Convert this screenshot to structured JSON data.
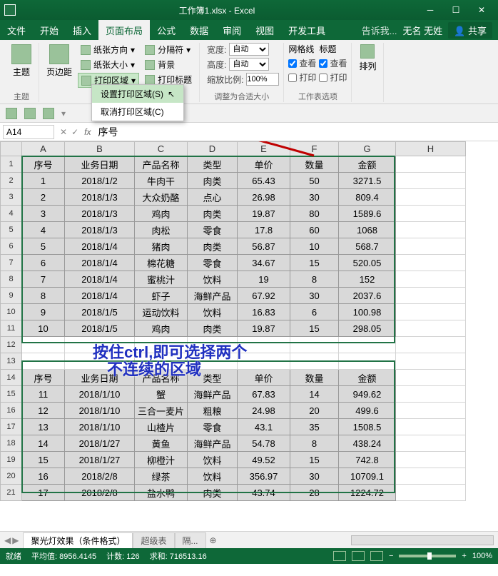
{
  "title": "工作簿1.xlsx - Excel",
  "menu": {
    "file": "文件",
    "home": "开始",
    "insert": "插入",
    "pageLayout": "页面布局",
    "formulas": "公式",
    "data": "数据",
    "review": "审阅",
    "view": "视图",
    "devtools": "开发工具",
    "tell": "告诉我...",
    "user": "无名 无姓",
    "share": "共享"
  },
  "ribbon": {
    "g_themes": {
      "label": "主题",
      "btn": "主题"
    },
    "g_margins": {
      "label": "",
      "btn": "页边距"
    },
    "g_pageSetup": {
      "orientation": "纸张方向",
      "size": "纸张大小",
      "printArea": "打印区域",
      "breaks": "分隔符",
      "background": "背景",
      "printTitles": "打印标题"
    },
    "g_printAreaMenu": {
      "set": "设置打印区域(S)",
      "clear": "取消打印区域(C)"
    },
    "g_scale": {
      "groupLabel": "调整为合适大小",
      "width": "宽度:",
      "widthVal": "自动",
      "height": "高度:",
      "heightVal": "自动",
      "scale": "缩放比例:",
      "scaleVal": "100%"
    },
    "g_gridlines": {
      "gridlines": "网格线",
      "headings": "标题",
      "view": "查看",
      "print": "打印",
      "groupLabel": "工作表选项"
    },
    "g_arrange": {
      "btn": "排列"
    }
  },
  "nameBox": "A14",
  "formula": "序号",
  "columns": [
    "",
    "A",
    "B",
    "C",
    "D",
    "E",
    "F",
    "G",
    "H"
  ],
  "headers": [
    "序号",
    "业务日期",
    "产品名称",
    "类型",
    "单价",
    "数量",
    "金额"
  ],
  "rows1": [
    [
      "1",
      "2018/1/2",
      "牛肉干",
      "肉类",
      "65.43",
      "50",
      "3271.5"
    ],
    [
      "2",
      "2018/1/3",
      "大众奶酪",
      "点心",
      "26.98",
      "30",
      "809.4"
    ],
    [
      "3",
      "2018/1/3",
      "鸡肉",
      "肉类",
      "19.87",
      "80",
      "1589.6"
    ],
    [
      "4",
      "2018/1/3",
      "肉松",
      "零食",
      "17.8",
      "60",
      "1068"
    ],
    [
      "5",
      "2018/1/4",
      "猪肉",
      "肉类",
      "56.87",
      "10",
      "568.7"
    ],
    [
      "6",
      "2018/1/4",
      "棉花糖",
      "零食",
      "34.67",
      "15",
      "520.05"
    ],
    [
      "7",
      "2018/1/4",
      "蜜桃汁",
      "饮料",
      "19",
      "8",
      "152"
    ],
    [
      "8",
      "2018/1/4",
      "虾子",
      "海鲜产品",
      "67.92",
      "30",
      "2037.6"
    ],
    [
      "9",
      "2018/1/5",
      "运动饮料",
      "饮料",
      "16.83",
      "6",
      "100.98"
    ],
    [
      "10",
      "2018/1/5",
      "鸡肉",
      "肉类",
      "19.87",
      "15",
      "298.05"
    ]
  ],
  "rows2": [
    [
      "11",
      "2018/1/10",
      "蟹",
      "海鲜产品",
      "67.83",
      "14",
      "949.62"
    ],
    [
      "12",
      "2018/1/10",
      "三合一麦片",
      "粗粮",
      "24.98",
      "20",
      "499.6"
    ],
    [
      "13",
      "2018/1/10",
      "山楂片",
      "零食",
      "43.1",
      "35",
      "1508.5"
    ],
    [
      "14",
      "2018/1/27",
      "黄鱼",
      "海鲜产品",
      "54.78",
      "8",
      "438.24"
    ],
    [
      "15",
      "2018/1/27",
      "柳橙汁",
      "饮料",
      "49.52",
      "15",
      "742.8"
    ],
    [
      "16",
      "2018/2/8",
      "绿茶",
      "饮料",
      "356.97",
      "30",
      "10709.1"
    ],
    [
      "17",
      "2018/2/8",
      "盐水鸭",
      "肉类",
      "43.74",
      "28",
      "1224.72"
    ]
  ],
  "annotation": {
    "l1": "按住ctrl,即可选择两个",
    "l2": "不连续的区域"
  },
  "sheetTabs": {
    "t1": "聚光灯效果（条件格式）",
    "t2": "超级表",
    "t3": "隔..."
  },
  "status": {
    "ready": "就绪",
    "avg": "平均值: 8956.4145",
    "count": "计数: 126",
    "sum": "求和: 716513.16",
    "zoom": "100%"
  }
}
